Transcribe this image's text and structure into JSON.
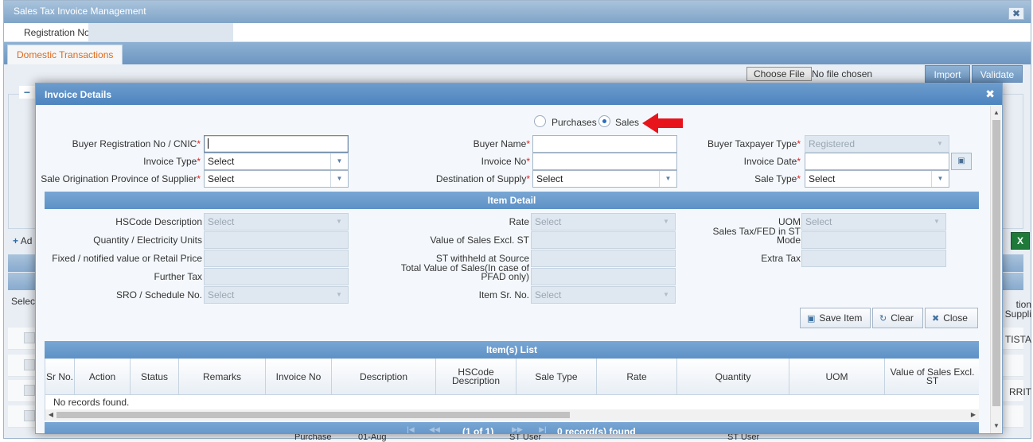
{
  "window": {
    "title": "Sales Tax Invoice Management",
    "close": "✖"
  },
  "registration": {
    "label": "Registration No"
  },
  "tabs": [
    {
      "label": "Domestic Transactions"
    }
  ],
  "toolbar": {
    "choose_file": "Choose File",
    "no_file": "No file chosen",
    "import": "Import",
    "validate": "Validate"
  },
  "background": {
    "add_label": "Ad",
    "select_label": "Selec",
    "right_col_line1": "tion",
    "right_col_line2": "Suppli",
    "row_text_1": "TISTA",
    "row_text_2": "RRIT",
    "bottom_1": "Purchase",
    "bottom_2": "01-Aug",
    "bottom_3": "ST User",
    "bottom_4": "ST User"
  },
  "modal": {
    "title": "Invoice Details",
    "close": "✖",
    "radio": {
      "purchases": "Purchases",
      "sales": "Sales",
      "selected": "sales"
    },
    "header_fields": {
      "buyer_reg": {
        "label": "Buyer Registration No / CNIC",
        "value": ""
      },
      "buyer_name": {
        "label": "Buyer Name",
        "value": ""
      },
      "buyer_taxpayer_type": {
        "label": "Buyer Taxpayer Type",
        "value": "Registered"
      },
      "invoice_type": {
        "label": "Invoice Type",
        "value": "Select"
      },
      "invoice_no": {
        "label": "Invoice No",
        "value": ""
      },
      "invoice_date": {
        "label": "Invoice Date",
        "value": ""
      },
      "sale_origin": {
        "label": "Sale Origination Province of Supplier",
        "value": "Select"
      },
      "destination": {
        "label": "Destination of Supply",
        "value": "Select"
      },
      "sale_type": {
        "label": "Sale Type",
        "value": "Select"
      }
    },
    "required_mark": "*",
    "item_detail_title": "Item Detail",
    "item_fields": {
      "hscode_desc": {
        "label": "HSCode Description",
        "value": "Select"
      },
      "rate": {
        "label": "Rate",
        "value": "Select"
      },
      "uom": {
        "label": "UOM",
        "value": "Select"
      },
      "quantity": {
        "label": "Quantity / Electricity Units"
      },
      "value_excl": {
        "label": "Value of Sales Excl. ST"
      },
      "sales_tax_fed": {
        "label": "Sales Tax/FED in ST Mode"
      },
      "fixed_value": {
        "label": "Fixed / notified value or Retail Price"
      },
      "st_withheld": {
        "label": "ST withheld at Source"
      },
      "extra_tax": {
        "label": "Extra Tax"
      },
      "further_tax": {
        "label": "Further Tax"
      },
      "total_value": {
        "label": "Total Value of Sales(In case of PFAD only)"
      },
      "sro": {
        "label": "SRO / Schedule No.",
        "value": "Select"
      },
      "item_sr_no": {
        "label": "Item Sr. No.",
        "value": "Select"
      }
    },
    "buttons": {
      "save_item": "Save Item",
      "clear": "Clear",
      "close": "Close"
    },
    "items_list_title": "Item(s) List",
    "table": {
      "columns": [
        "Sr No.",
        "Action",
        "Status",
        "Remarks",
        "Invoice No",
        "Description",
        "HSCode Description",
        "Sale Type",
        "Rate",
        "Quantity",
        "UOM",
        "Value of Sales Excl. ST"
      ],
      "empty_text": "No records found."
    },
    "pager": {
      "page_text": "(1 of 1)",
      "records_text": "0 record(s) found"
    }
  },
  "colors": {
    "accent": "#4d84bf",
    "required": "#e02020",
    "tab_text": "#e06a1c",
    "arrow": "#e8141c"
  }
}
